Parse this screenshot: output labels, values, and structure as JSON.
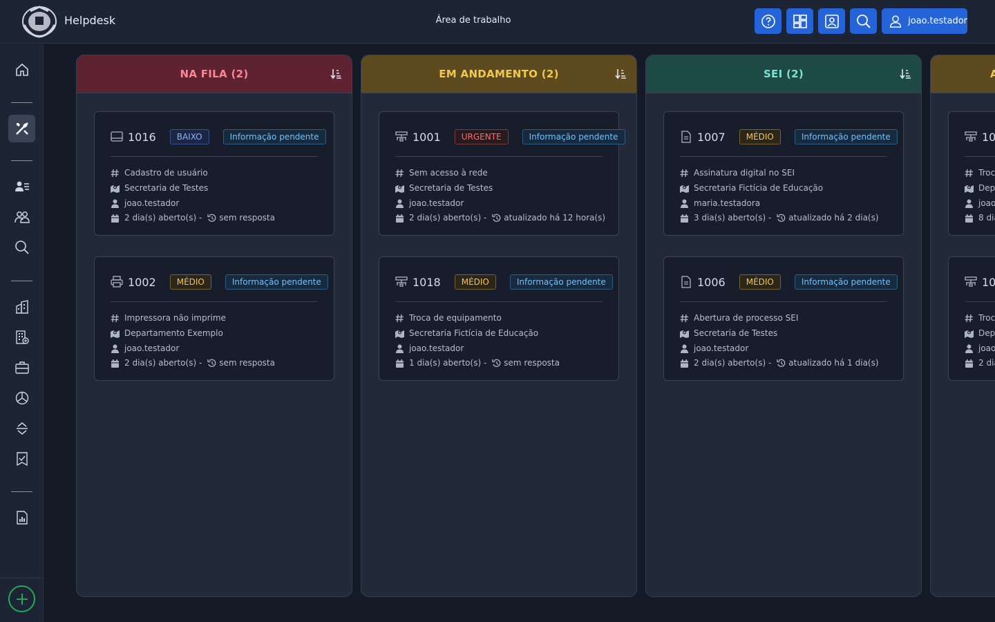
{
  "header": {
    "app_title": "Helpdesk",
    "workspace_title": "Área de trabalho",
    "user": "joao.testador",
    "buttons": [
      "help-icon",
      "dashboard-icon",
      "portrait-icon",
      "search-icon"
    ]
  },
  "sidebar": {
    "items": [
      "home-icon",
      "tools-icon",
      "user-list-icon",
      "users-icon",
      "search-icon",
      "building-icon",
      "building-grid-icon",
      "briefcase-icon",
      "pie-chart-icon",
      "expand-collapse-icon",
      "bookmark-check-icon",
      "report-icon",
      "add-icon"
    ],
    "active": "tools-icon"
  },
  "colors": {
    "accent": "#2563d8",
    "fila": "#5e2231",
    "fila_text": "#ff8593",
    "andamento": "#5e4a1f",
    "andamento_text": "#f2c94c",
    "sei": "#1d4a44",
    "sei_text": "#7be3d2",
    "add": "#22a85a"
  },
  "columns": [
    {
      "title": "NA FILA (2)",
      "cards": [
        {
          "icon": "monitor-icon",
          "number": "1016",
          "priority": "BAIXO",
          "status": "Informação pendente",
          "subject": "Cadastro de usuário",
          "department": "Secretaria de Testes",
          "user": "joao.testador",
          "opened": "2 dia(s) aberto(s) -",
          "updated": "sem resposta"
        },
        {
          "icon": "printer-icon",
          "number": "1002",
          "priority": "MÉDIO",
          "status": "Informação pendente",
          "subject": "Impressora não imprime",
          "department": "Departamento Exemplo",
          "user": "joao.testador",
          "opened": "2 dia(s) aberto(s) -",
          "updated": "sem resposta"
        }
      ]
    },
    {
      "title": "EM ANDAMENTO (2)",
      "cards": [
        {
          "icon": "network-icon",
          "number": "1001",
          "priority": "URGENTE",
          "status": "Informação pendente",
          "subject": "Sem acesso à rede",
          "department": "Secretaria de Testes",
          "user": "joao.testador",
          "opened": "2 dia(s) aberto(s) -",
          "updated": "atualizado há 12 hora(s)"
        },
        {
          "icon": "network-icon",
          "number": "1018",
          "priority": "MÉDIO",
          "status": "Informação pendente",
          "subject": "Troca de equipamento",
          "department": "Secretaria Fictícia de Educação",
          "user": "joao.testador",
          "opened": "1 dia(s) aberto(s) -",
          "updated": "sem resposta"
        }
      ]
    },
    {
      "title": "SEI (2)",
      "cards": [
        {
          "icon": "document-icon",
          "number": "1007",
          "priority": "MÉDIO",
          "status": "Informação pendente",
          "subject": "Assinatura digital no SEI",
          "department": "Secretaria Fictícia de Educação",
          "user": "maria.testadora",
          "opened": "3 dia(s) aberto(s) -",
          "updated": "atualizado há 2 dia(s)"
        },
        {
          "icon": "document-icon",
          "number": "1006",
          "priority": "MÉDIO",
          "status": "Informação pendente",
          "subject": "Abertura de processo SEI",
          "department": "Secretaria de Testes",
          "user": "joao.testador",
          "opened": "2 dia(s) aberto(s) -",
          "updated": "atualizado há 1 dia(s)"
        }
      ]
    },
    {
      "title": "A",
      "cards": [
        {
          "icon": "network-icon",
          "number": "10",
          "subject": "Troc",
          "department": "Dep",
          "user": "joao.",
          "opened": "8 dia"
        },
        {
          "icon": "network-icon",
          "number": "10",
          "subject": "Troc",
          "department": "Dep",
          "user": "joao.",
          "opened": "2 dia"
        }
      ]
    }
  ]
}
